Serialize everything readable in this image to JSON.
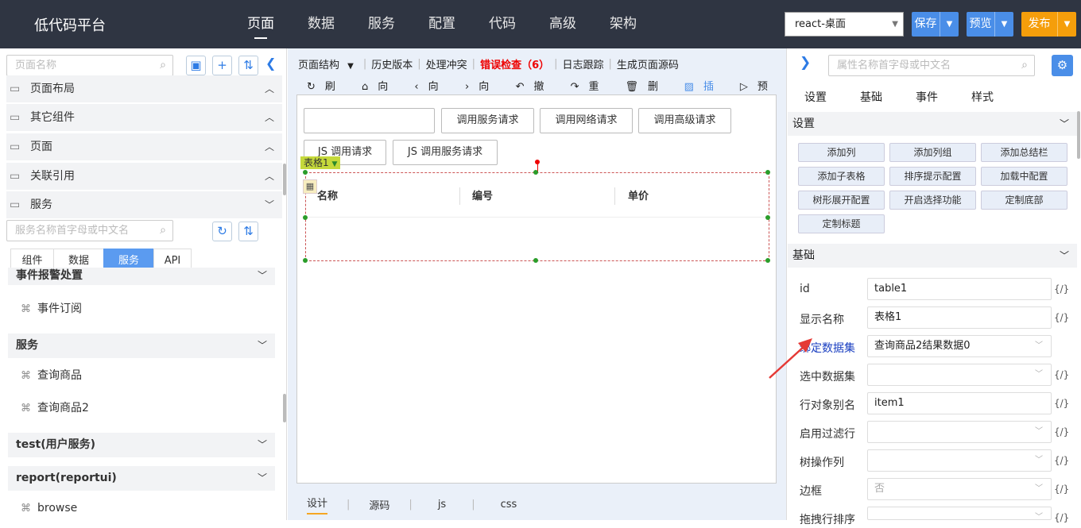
{
  "app": {
    "title": "低代码平台"
  },
  "nav": [
    "页面",
    "数据",
    "服务",
    "配置",
    "代码",
    "高级",
    "架构"
  ],
  "env": {
    "value": "react-桌面"
  },
  "actions": {
    "save": "保存",
    "preview": "预览",
    "publish": "发布"
  },
  "left": {
    "page_search_placeholder": "页面名称",
    "groups": [
      "页面布局",
      "其它组件",
      "页面",
      "关联引用",
      "服务"
    ],
    "service_search_placeholder": "服务名称首字母或中文名",
    "tabs": [
      "组件",
      "数据",
      "服务",
      "API"
    ],
    "sections": [
      {
        "title": "事件报警处置",
        "items": [
          "事件订阅"
        ]
      },
      {
        "title": "服务",
        "items": [
          "查询商品",
          "查询商品2"
        ]
      },
      {
        "title": "test(用户服务)",
        "items": []
      },
      {
        "title": "report(reportui)",
        "items": [
          "browse"
        ]
      }
    ]
  },
  "mid": {
    "toolbar": {
      "structure": "页面结构",
      "history": "历史版本",
      "conflict": "处理冲突",
      "errors": "错误检查（6）",
      "log": "日志跟踪",
      "source": "生成页面源码"
    },
    "acts": [
      "刷新",
      "向上",
      "向前",
      "向后",
      "撤销",
      "重做",
      "删除",
      "插图",
      "预览"
    ],
    "buttons": [
      "调用服务请求",
      "调用网络请求",
      "调用高级请求",
      "JS 调用请求",
      "JS 调用服务请求"
    ],
    "table": {
      "tag": "表格1",
      "columns": [
        "名称",
        "编号",
        "单价"
      ]
    },
    "bottom_tabs": [
      "设计",
      "源码",
      "js",
      "css"
    ]
  },
  "right": {
    "search_placeholder": "属性名称首字母或中文名",
    "tabs": [
      "设置",
      "基础",
      "事件",
      "样式"
    ],
    "settings_title": "设置",
    "setting_buttons": [
      "添加列",
      "添加列组",
      "添加总结栏",
      "添加子表格",
      "排序提示配置",
      "加载中配置",
      "树形展开配置",
      "开启选择功能",
      "定制底部",
      "定制标题"
    ],
    "basic_title": "基础",
    "props": [
      {
        "label": "id",
        "value": "table1",
        "kind": "text"
      },
      {
        "label": "显示名称",
        "value": "表格1",
        "kind": "text"
      },
      {
        "label": "绑定数据集",
        "value": "查询商品2结果数据0",
        "kind": "select"
      },
      {
        "label": "选中数据集",
        "value": "",
        "kind": "select"
      },
      {
        "label": "行对象别名",
        "value": "item1",
        "kind": "text"
      },
      {
        "label": "启用过滤行",
        "value": "",
        "kind": "select"
      },
      {
        "label": "树操作列",
        "value": "",
        "kind": "select"
      },
      {
        "label": "边框",
        "value": "否",
        "kind": "select"
      },
      {
        "label": "拖拽行排序",
        "value": "",
        "kind": "select"
      }
    ],
    "fx": "{/}"
  },
  "colors": {
    "topbar": "#2f3542",
    "accent": "#4a8ee8",
    "publish": "#f59e0b",
    "error": "#e00000",
    "link_label": "#1a3fc1"
  }
}
